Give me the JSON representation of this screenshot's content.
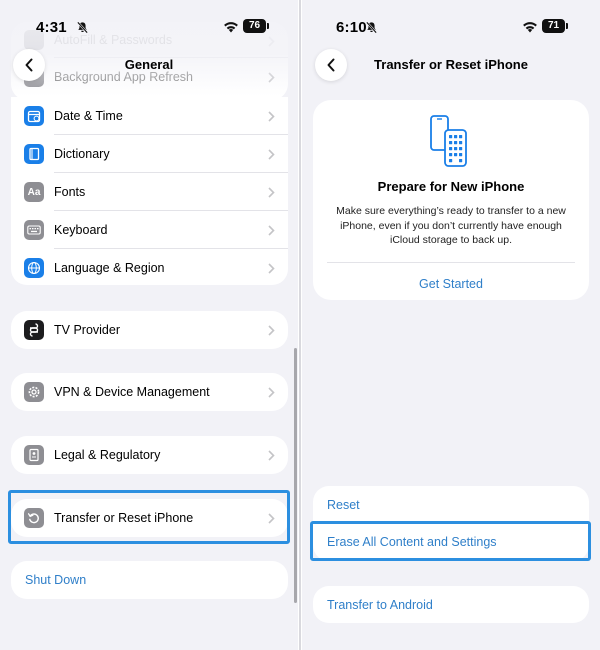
{
  "left": {
    "status": {
      "time": "4:31",
      "battery": "76"
    },
    "nav": {
      "title": "General"
    },
    "faded_rows": [
      "AutoFill & Passwords",
      "Background App Refresh"
    ],
    "group1": [
      {
        "label": "Date & Time",
        "icon": "clock-calendar-icon",
        "icon_color": "#1a7fe8"
      },
      {
        "label": "Dictionary",
        "icon": "book-icon",
        "icon_color": "#1a7fe8"
      },
      {
        "label": "Fonts",
        "icon": "fonts-aa-icon",
        "icon_color": "#8e8e93"
      },
      {
        "label": "Keyboard",
        "icon": "keyboard-icon",
        "icon_color": "#8e8e93"
      },
      {
        "label": "Language & Region",
        "icon": "globe-icon",
        "icon_color": "#1a7fe8"
      }
    ],
    "tv_provider": {
      "label": "TV Provider",
      "icon": "tv-provider-icon",
      "icon_color": "#1c1c1e"
    },
    "vpn": {
      "label": "VPN & Device Management",
      "icon": "gear-icon",
      "icon_color": "#8e8e93"
    },
    "legal": {
      "label": "Legal & Regulatory",
      "icon": "document-icon",
      "icon_color": "#8e8e93"
    },
    "transfer": {
      "label": "Transfer or Reset iPhone",
      "icon": "reset-arrow-icon",
      "icon_color": "#8e8e93"
    },
    "shutdown": {
      "label": "Shut Down"
    }
  },
  "right": {
    "status": {
      "time": "6:10",
      "battery": "71"
    },
    "nav": {
      "title": "Transfer or Reset iPhone"
    },
    "prepare_card": {
      "icon": "two-phones-icon",
      "heading": "Prepare for New iPhone",
      "description": "Make sure everything’s ready to transfer to a new iPhone, even if you don’t currently have enough iCloud storage to back up.",
      "action": "Get Started"
    },
    "reset_options": [
      "Reset",
      "Erase All Content and Settings"
    ],
    "transfer_android": "Transfer to Android"
  },
  "colors": {
    "accent": "#2f7fc9",
    "highlight": "#2c8fe0",
    "background": "#f2f2f7"
  }
}
